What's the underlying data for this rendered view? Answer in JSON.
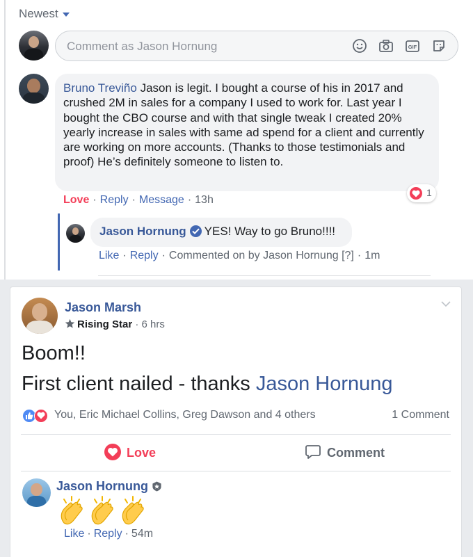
{
  "sort": {
    "label": "Newest"
  },
  "composer": {
    "placeholder": "Comment as Jason Hornung",
    "icons": [
      "emoji-icon",
      "camera-icon",
      "gif-icon",
      "sticker-icon"
    ]
  },
  "comment1": {
    "author": "Bruno Treviño",
    "text": "Jason is legit. I bought a course of his in 2017 and crushed 2M in sales for a company I used to work for. Last year I bought the CBO course and with that single tweak I created 20% yearly increase in sales with same ad spend for a client and currently are working on more accounts. (Thanks to those testimonials and proof) He’s definitely someone to listen to.",
    "reaction_label": "Love",
    "reply_label": "Reply",
    "message_label": "Message",
    "time": "13h",
    "reaction_count": "1"
  },
  "reply1": {
    "author": "Jason Hornung",
    "text": "YES! Way to go Bruno!!!!",
    "like_label": "Like",
    "reply_label": "Reply",
    "commented_on_by": "Commented on by Jason Hornung [?]",
    "time": "1m"
  },
  "post": {
    "author": "Jason Marsh",
    "badge": "Rising Star",
    "time": "6 hrs",
    "line1": "Boom!!",
    "line2_prefix": "First client nailed - thanks ",
    "line2_tag": "Jason Hornung",
    "reacted_by": "You, Eric Michael Collins, Greg Dawson and 4 others",
    "comment_count": "1 Comment",
    "love_label": "Love",
    "comment_label": "Comment"
  },
  "post_comment": {
    "author": "Jason Hornung",
    "content": "👏👏👏",
    "like_label": "Like",
    "reply_label": "Reply",
    "time": "54m"
  },
  "colors": {
    "link": "#385898",
    "accent": "#4267b2",
    "love": "#f33e58",
    "meta": "#606770"
  }
}
